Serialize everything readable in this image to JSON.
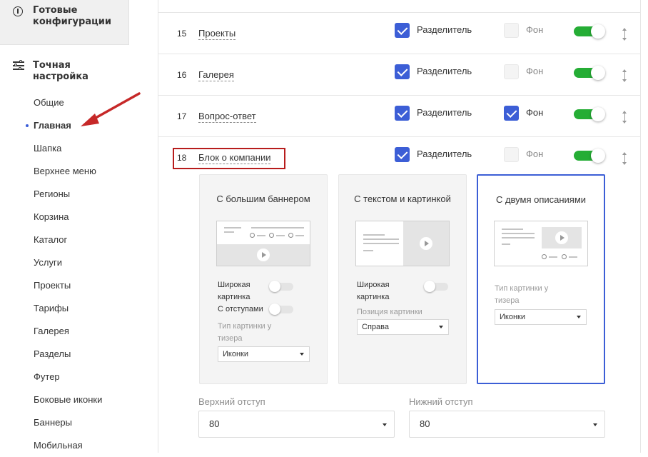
{
  "sidebar": {
    "ready_configs_label": "Готовые конфигурации",
    "fine_tuning_label": "Точная настройка",
    "items": [
      {
        "label": "Общие",
        "active": false
      },
      {
        "label": "Главная",
        "active": true
      },
      {
        "label": "Шапка",
        "active": false
      },
      {
        "label": "Верхнее меню",
        "active": false
      },
      {
        "label": "Регионы",
        "active": false
      },
      {
        "label": "Корзина",
        "active": false
      },
      {
        "label": "Каталог",
        "active": false
      },
      {
        "label": "Услуги",
        "active": false
      },
      {
        "label": "Проекты",
        "active": false
      },
      {
        "label": "Тарифы",
        "active": false
      },
      {
        "label": "Галерея",
        "active": false
      },
      {
        "label": "Разделы",
        "active": false
      },
      {
        "label": "Футер",
        "active": false
      },
      {
        "label": "Боковые иконки",
        "active": false
      },
      {
        "label": "Баннеры",
        "active": false
      },
      {
        "label": "Мобильная",
        "active": false
      }
    ]
  },
  "rows": [
    {
      "number": "15",
      "name": "Проекты",
      "separator_label": "Разделитель",
      "separator_checked": true,
      "background_label": "Фон",
      "background_checked": false,
      "enabled": true
    },
    {
      "number": "16",
      "name": "Галерея",
      "separator_label": "Разделитель",
      "separator_checked": true,
      "background_label": "Фон",
      "background_checked": false,
      "enabled": true
    },
    {
      "number": "17",
      "name": "Вопрос-ответ",
      "separator_label": "Разделитель",
      "separator_checked": true,
      "background_label": "Фон",
      "background_checked": true,
      "enabled": true
    },
    {
      "number": "18",
      "name": "Блок о компании",
      "separator_label": "Разделитель",
      "separator_checked": true,
      "background_label": "Фон",
      "background_checked": false,
      "enabled": true
    }
  ],
  "cards": [
    {
      "title": "С большим баннером",
      "selected": false,
      "wide_image_label": "Широкая картинка",
      "indents_label": "С отступами",
      "teaser_type_label": "Тип картинки у тизера",
      "teaser_type_value": "Иконки"
    },
    {
      "title": "С текстом и картинкой",
      "selected": false,
      "wide_image_label": "Широкая картинка",
      "image_position_label": "Позиция картинки",
      "image_position_value": "Справа"
    },
    {
      "title": "С двумя описаниями",
      "selected": true,
      "teaser_type_label": "Тип картинки у тизера",
      "teaser_type_value": "Иконки"
    }
  ],
  "fields": {
    "top_indent_label": "Верхний отступ",
    "top_indent_value": "80",
    "bottom_indent_label": "Нижний отступ",
    "bottom_indent_value": "80"
  },
  "colors": {
    "accent": "#3c5ed6",
    "toggle_on": "#25ad35",
    "highlight_red": "#b71c1c",
    "arrow_red": "#c62828"
  }
}
